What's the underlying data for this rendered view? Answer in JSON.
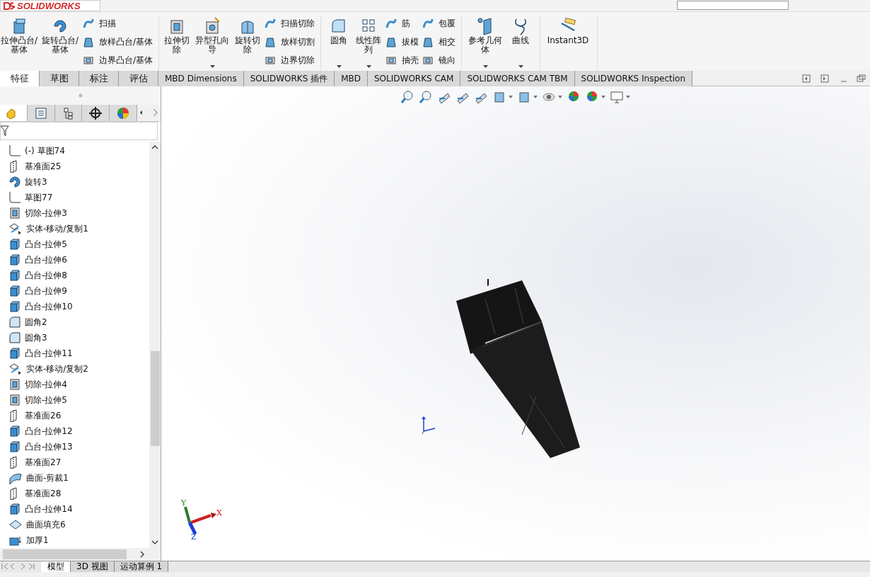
{
  "app": {
    "logo": "SOLIDWORKS"
  },
  "ribbon": [
    {
      "items": [
        {
          "kind": "large",
          "label": "拉伸凸台/基体",
          "dropdown": false
        },
        {
          "kind": "large",
          "label": "旋转凸台/基体",
          "dropdown": false
        },
        {
          "kind": "column",
          "children": [
            {
              "label": "扫描"
            },
            {
              "label": "放样凸台/基体"
            },
            {
              "label": "边界凸台/基体"
            }
          ]
        }
      ]
    },
    {
      "items": [
        {
          "kind": "large",
          "label": "拉伸切除",
          "dropdown": false
        },
        {
          "kind": "large",
          "label": "异型孔向导",
          "dropdown": true
        },
        {
          "kind": "large",
          "label": "旋转切除",
          "dropdown": false
        },
        {
          "kind": "column",
          "children": [
            {
              "label": "扫描切除"
            },
            {
              "label": "放样切割"
            },
            {
              "label": "边界切除"
            }
          ]
        }
      ]
    },
    {
      "items": [
        {
          "kind": "large",
          "label": "圆角",
          "dropdown": true
        },
        {
          "kind": "large",
          "label": "线性阵列",
          "dropdown": true
        },
        {
          "kind": "column",
          "children": [
            {
              "label": "筋"
            },
            {
              "label": "拔模"
            },
            {
              "label": "抽壳"
            }
          ]
        },
        {
          "kind": "column",
          "children": [
            {
              "label": "包覆"
            },
            {
              "label": "相交"
            },
            {
              "label": "镜向"
            }
          ]
        }
      ]
    },
    {
      "items": [
        {
          "kind": "large",
          "label": "参考几何体",
          "dropdown": true
        },
        {
          "kind": "large",
          "label": "曲线",
          "dropdown": true
        }
      ]
    },
    {
      "items": [
        {
          "kind": "large",
          "label": "Instant3D",
          "dropdown": false
        }
      ]
    }
  ],
  "tabs": [
    {
      "label": "特征",
      "selected": true
    },
    {
      "label": "草图",
      "selected": false
    },
    {
      "label": "标注",
      "selected": false
    },
    {
      "label": "评估",
      "selected": false
    },
    {
      "label": "MBD Dimensions",
      "selected": false
    },
    {
      "label": "SOLIDWORKS 插件",
      "selected": false
    },
    {
      "label": "MBD",
      "selected": false
    },
    {
      "label": "SOLIDWORKS CAM",
      "selected": false
    },
    {
      "label": "SOLIDWORKS CAM TBM",
      "selected": false
    },
    {
      "label": "SOLIDWORKS Inspection",
      "selected": false
    }
  ],
  "panel_tabs": [
    {
      "selected": true
    },
    {
      "selected": false
    },
    {
      "selected": false
    },
    {
      "selected": false
    },
    {
      "selected": false
    }
  ],
  "tree": [
    {
      "kind": "sketch",
      "label": "(-) 草图74"
    },
    {
      "kind": "plane",
      "label": "基准面25"
    },
    {
      "kind": "revolve",
      "label": "旋转3"
    },
    {
      "kind": "sketch",
      "label": "草图77"
    },
    {
      "kind": "cut",
      "label": "切除-拉伸3"
    },
    {
      "kind": "move",
      "label": "实体-移动/复制1"
    },
    {
      "kind": "boss",
      "label": "凸台-拉伸5"
    },
    {
      "kind": "boss",
      "label": "凸台-拉伸6"
    },
    {
      "kind": "boss",
      "label": "凸台-拉伸8"
    },
    {
      "kind": "boss",
      "label": "凸台-拉伸9"
    },
    {
      "kind": "boss",
      "label": "凸台-拉伸10"
    },
    {
      "kind": "fillet",
      "label": "圆角2"
    },
    {
      "kind": "fillet",
      "label": "圆角3"
    },
    {
      "kind": "boss",
      "label": "凸台-拉伸11"
    },
    {
      "kind": "move",
      "label": "实体-移动/复制2"
    },
    {
      "kind": "cut",
      "label": "切除-拉伸4"
    },
    {
      "kind": "cut",
      "label": "切除-拉伸5"
    },
    {
      "kind": "plane",
      "label": "基准面26"
    },
    {
      "kind": "boss",
      "label": "凸台-拉伸12"
    },
    {
      "kind": "boss",
      "label": "凸台-拉伸13"
    },
    {
      "kind": "plane",
      "label": "基准面27"
    },
    {
      "kind": "trim",
      "label": "曲面-剪裁1"
    },
    {
      "kind": "plane",
      "label": "基准面28"
    },
    {
      "kind": "boss",
      "label": "凸台-拉伸14"
    },
    {
      "kind": "fill",
      "label": "曲面填充6"
    },
    {
      "kind": "thicken",
      "label": "加厚1"
    }
  ],
  "triad": {
    "x": "X",
    "y": "Y",
    "z": "Z"
  },
  "bottom_tabs": [
    {
      "label": "模型",
      "selected": true
    },
    {
      "label": "3D 视图",
      "selected": false
    },
    {
      "label": "运动算例 1",
      "selected": false
    }
  ]
}
